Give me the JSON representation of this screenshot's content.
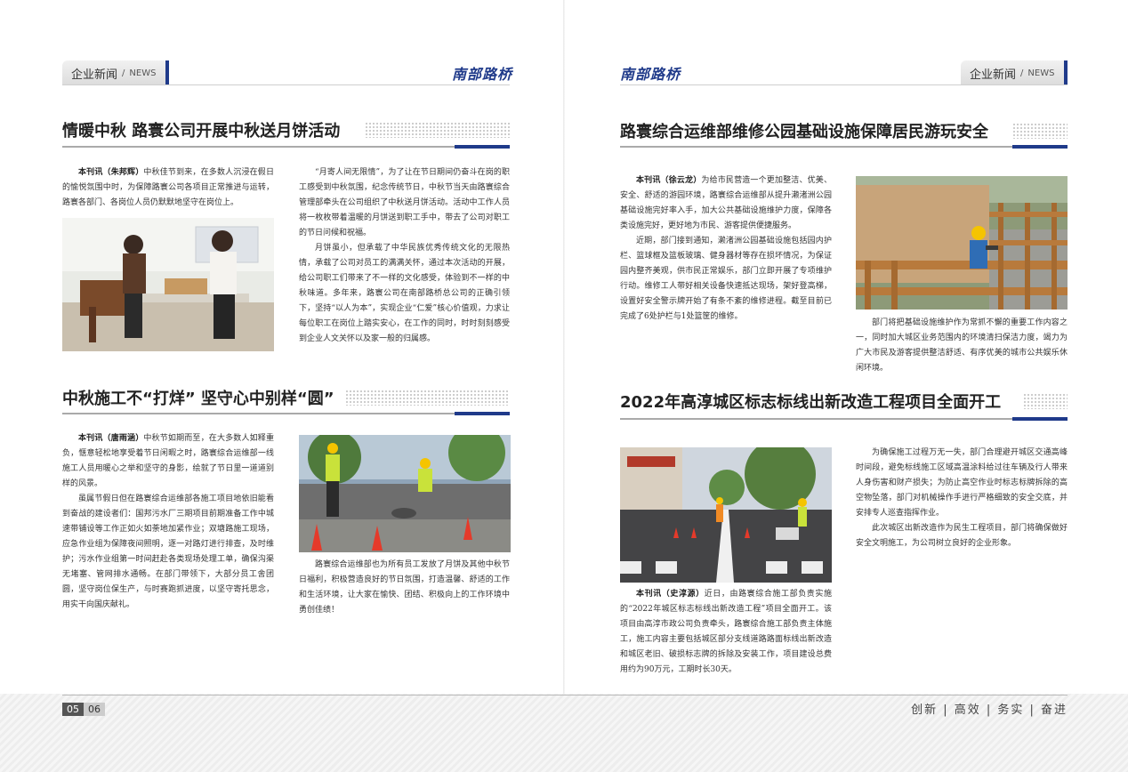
{
  "header": {
    "section_cn": "企业新闻",
    "section_sep": "/",
    "section_en": "NEWS",
    "brand": "南部路桥"
  },
  "articles": {
    "a1": {
      "title": "情暖中秋 路寰公司开展中秋送月饼活动",
      "byline": "本刊讯（朱邦辉）",
      "p1": "中秋佳节到来，在多数人沉浸在假日的愉悦氛围中时，为保障路寰公司各项目正常推进与运转，路寰各部门、各岗位人员仍默默地坚守在岗位上。",
      "p2": "“月寄人间无限情”，为了让在节日期间仍奋斗在岗的职工感受到中秋氛围，纪念传统节日，中秋节当天由路寰综合管理部牵头在公司组织了中秋送月饼活动。活动中工作人员将一枚枚带着温暖的月饼送到职工手中，带去了公司对职工的节日问候和祝福。",
      "p3": "月饼虽小，但承载了中华民族优秀传统文化的无限热情，承载了公司对员工的满满关怀，通过本次活动的开展，给公司职工们带来了不一样的文化感受，体验到不一样的中秋味道。多年来，路寰公司在南部路桥总公司的正确引领下，坚持“以人为本”，实现企业“仁爱”核心价值观，力求让每位职工在岗位上踏实安心，在工作的同时，时时刻刻感受到企业人文关怀以及家一般的归属感。"
    },
    "a2": {
      "title": "中秋施工不“打烊” 坚守心中别样“圆”",
      "byline": "本刊讯（唐雨涵）",
      "p1": "中秋节如期而至，在大多数人如释重负，惬意轻松地享受着节日闲暇之时，路寰综合运维部一线施工人员用暖心之举和坚守的身影，绘就了节日里一道道别样的风景。",
      "p2": "虽属节假日但在路寰综合运维部各施工项目地依旧能看到奋战的建设者们：国邦污水厂三期项目前期准备工作中城速带铺设等工作正如火如荼地加紧作业；双塘路施工现场，应急作业组为保障夜间照明，逐一对路灯进行排查，及时维护；污水作业组第一时间赶赴各类现场处理工单，确保沟渠无堵塞、管网排水通畅。在部门带领下，大部分员工舍团圆，坚守岗位保生产，与时赛跑抓进度，以坚守寄托思念，用实干向国庆献礼。",
      "p3": "路寰综合运维部也为所有员工发放了月饼及其他中秋节日福利，积极营造良好的节日氛围，打造温馨、舒适的工作和生活环境，让大家在愉快、团结、积极向上的工作环境中勇创佳绩！"
    },
    "a3": {
      "title": "路寰综合运维部维修公园基础设施保障居民游玩安全",
      "byline": "本刊讯（徐云龙）",
      "p1": "为给市民营造一个更加整洁、优美、安全、舒适的游园环境，路寰综合运维部从提升濑渚洲公园基础设施完好率入手，加大公共基础设施维护力度，保障各类设施完好，更好地为市民、游客提供便捷服务。",
      "p2": "近期，部门接到通知，濑渚洲公园基础设施包括园内护栏、篮球框及篮板玻璃、健身器材等存在损坏情况，为保证园内整齐美观，供市民正常娱乐，部门立即开展了专项维护行动。维修工人带好相关设备快速抵达现场，架好登高梯，设置好安全警示牌开始了有条不紊的维修进程。截至目前已完成了6处护栏与1处篮筐的维修。",
      "p3": "部门将把基础设施维护作为常抓不懈的重要工作内容之一，同时加大城区业务范围内的环境清扫保洁力度，竭力为广大市民及游客提供整洁舒适、有序优美的城市公共娱乐休闲环境。"
    },
    "a4": {
      "title": "2022年高淳城区标志标线出新改造工程项目全面开工",
      "byline": "本刊讯（史淳源）",
      "p1": "近日，由路寰综合施工部负责实施的“2022年城区标志标线出新改造工程”项目全面开工。该项目由高淳市政公司负责牵头，路寰综合施工部负责主体施工，施工内容主要包括城区部分支线道路路面标线出新改造和城区老旧、破损标志牌的拆除及安装工作，项目建设总费用约为90万元，工期时长30天。",
      "p2": "为确保施工过程万无一失，部门合理避开城区交通高峰时间段，避免标线施工区域高温涂料给过往车辆及行人带来人身伤害和财产损失；为防止高空作业时标志标牌拆除的高空物坠落，部门对机械操作手进行严格细致的安全交底，并安排专人巡查指挥作业。",
      "p3": "此次城区出新改造作为民生工程项目，部门将确保做好安全文明施工，为公司树立良好的企业形象。"
    }
  },
  "footer": {
    "page_left": "05",
    "page_right": "06",
    "slogan": "创新 | 高效 | 务实 | 奋进"
  },
  "colors": {
    "accent": "#1f3a8a",
    "rule": "#aaaaaa"
  }
}
